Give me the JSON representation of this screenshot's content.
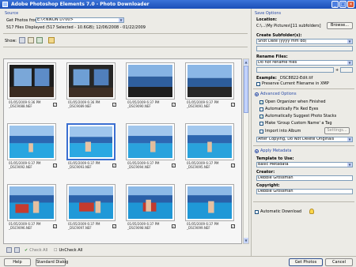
{
  "window": {
    "title": "Adobe Photoshop Elements 7.0 - Photo Downloader",
    "controls": [
      "_",
      "□",
      "×"
    ]
  },
  "source": {
    "heading": "Source",
    "get_photos_from_label": "Get Photos from:",
    "get_photos_from_value": "E:\\<NIKON D700>",
    "files_info": "517 Files Displayed (517 Selected - 10.6GB); 12/06/2008 - 01/22/2009"
  },
  "show_label": "Show:",
  "view_icons": [
    "grid-view-icon",
    "list-view-icon",
    "small-thumb-icon",
    "folder-icon"
  ],
  "thumbnails": [
    {
      "date": "01/05/2009 6:36 PM",
      "file": "_DSC9088.NEF",
      "selected": false,
      "checked": true
    },
    {
      "date": "01/05/2009 6:36 PM",
      "file": "_DSC9089.NEF",
      "selected": false,
      "checked": true
    },
    {
      "date": "01/05/2009 6:37 PM",
      "file": "_DSC9090.NEF",
      "selected": false,
      "checked": true
    },
    {
      "date": "01/05/2009 6:37 PM",
      "file": "_DSC9091.NEF",
      "selected": false,
      "checked": true
    },
    {
      "date": "01/05/2009 6:37 PM",
      "file": "_DSC9092.NEF",
      "selected": false,
      "checked": true
    },
    {
      "date": "01/05/2009 6:37 PM",
      "file": "_DSC9093.NEF",
      "selected": true,
      "checked": true
    },
    {
      "date": "01/05/2009 6:37 PM",
      "file": "_DSC9094.NEF",
      "selected": false,
      "checked": true
    },
    {
      "date": "01/05/2009 6:37 PM",
      "file": "_DSC9095.NEF",
      "selected": false,
      "checked": true
    },
    {
      "date": "01/05/2009 6:37 PM",
      "file": "_DSC9096.NEF",
      "selected": false,
      "checked": true
    },
    {
      "date": "01/05/2009 6:37 PM",
      "file": "_DSC9097.NEF",
      "selected": false,
      "checked": true
    },
    {
      "date": "01/05/2009 6:37 PM",
      "file": "_DSC9098.NEF",
      "selected": false,
      "checked": true
    },
    {
      "date": "01/05/2009 6:37 PM",
      "file": "_DSC9099.NEF",
      "selected": false,
      "checked": true
    }
  ],
  "check_all_label": "Check All",
  "uncheck_all_label": "UnCheck All",
  "save_options": {
    "heading": "Save Options",
    "location_label": "Location:",
    "location_value": "C:\\...\\My Pictures\\[11 subfolders]",
    "browse_label": "Browse...",
    "create_subfolders_label": "Create Subfolder(s):",
    "create_subfolders_value": "Shot Date (yyyy mm dd)",
    "rename_files_label": "Rename Files:",
    "rename_files_value": "Do not rename files",
    "plus": "+",
    "example_label": "Example:",
    "example_value": "_DSC8822-Edit.tif",
    "preserve_label": "Preserve Current Filename in XMP"
  },
  "advanced": {
    "heading": "Advanced Options",
    "options": [
      {
        "label": "Open Organizer when Finished",
        "checked": true
      },
      {
        "label": "Automatically Fix Red Eyes",
        "checked": false
      },
      {
        "label": "Automatically Suggest Photo Stacks",
        "checked": true
      },
      {
        "label": "Make 'Group Custom Name' a Tag",
        "checked": false
      }
    ],
    "import_album_label": "Import into Album",
    "settings_label": "Settings...",
    "after_copying_value": "After Copying, Do Not Delete Originals"
  },
  "metadata": {
    "heading": "Apply Metadata",
    "template_label": "Template to Use:",
    "template_value": "Basic Metadata",
    "creator_label": "Creator:",
    "creator_value": "Debbie Grossman",
    "copyright_label": "Copyright:",
    "copyright_value": "Debbie Grossman"
  },
  "automatic_download_label": "Automatic Download",
  "footer": {
    "help": "Help",
    "standard_dialog": "Standard Dialog",
    "get_photos": "Get Photos",
    "cancel": "Cancel"
  },
  "colors": {
    "title_bar": "#1b4fb8",
    "section_heading": "#2a4ca8",
    "selection": "#3b6fd1"
  }
}
